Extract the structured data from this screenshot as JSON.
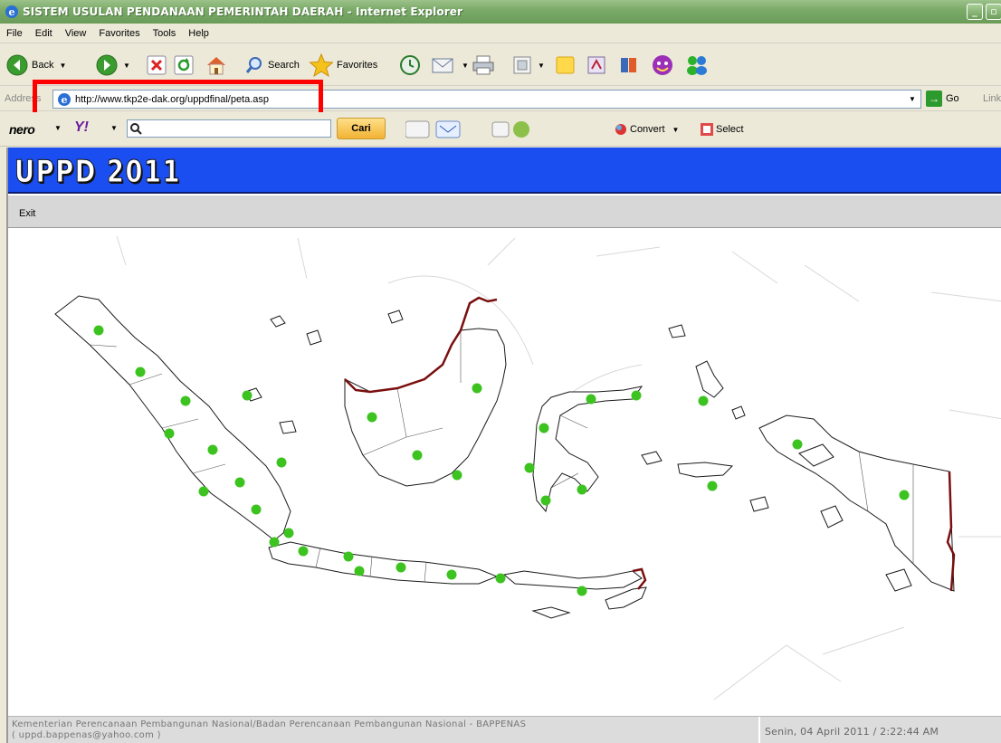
{
  "window": {
    "title": "SISTEM USULAN PENDANAAN PEMERINTAH DAERAH - Internet Explorer"
  },
  "menubar": [
    "File",
    "Edit",
    "View",
    "Favorites",
    "Tools",
    "Help"
  ],
  "toolbar": {
    "back_label": "Back",
    "search_label": "Search",
    "favorites_label": "Favorites"
  },
  "addressbar": {
    "label": "Address",
    "url": "http://www.tkp2e-dak.org/uppdfinal/peta.asp",
    "go_label": "Go",
    "links_label": "Links"
  },
  "nerobar": {
    "nero_label": "nero",
    "yahoo_label": "Y!",
    "search_button": "Cari",
    "convert_label": "Convert",
    "select_label": "Select"
  },
  "app": {
    "title": "UPPD 2011",
    "menu_exit": "Exit"
  },
  "map": {
    "marker_color": "#3cc31f",
    "border_color": "#7a0f0f"
  },
  "footer": {
    "line1": "Kementerian Perencanaan Pembangunan Nasional/Badan Perencanaan Pembangunan Nasional - BAPPENAS",
    "line2": "( uppd.bappenas@yahoo.com )",
    "datetime": "Senin, 04 April 2011 / 2:22:44 AM"
  }
}
